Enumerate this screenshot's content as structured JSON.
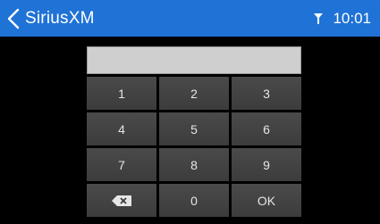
{
  "header": {
    "title": "SiriusXM",
    "time": "10:01",
    "back_icon": "chevron-left-icon",
    "signal_icon": "antenna-signal-icon",
    "bar_color": "#1f72d6"
  },
  "entry": {
    "value": ""
  },
  "keypad": {
    "keys": [
      "1",
      "2",
      "3",
      "4",
      "5",
      "6",
      "7",
      "8",
      "9"
    ],
    "zero": "0",
    "ok": "OK",
    "backspace_icon": "backspace-icon"
  }
}
